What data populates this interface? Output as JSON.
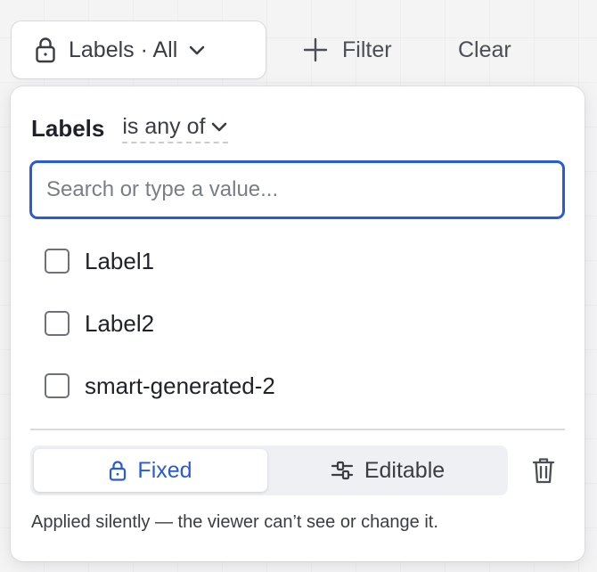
{
  "toolbar": {
    "labels_pill": {
      "label": "Labels · All",
      "lock_icon": "lock-icon",
      "chevron_icon": "chevron-down-icon"
    },
    "filter_button": {
      "label": "Filter",
      "icon": "plus-icon"
    },
    "clear_button": {
      "label": "Clear"
    }
  },
  "popover": {
    "title": "Labels",
    "operator": "is any of",
    "search": {
      "placeholder": "Search or type a value...",
      "value": ""
    },
    "options": [
      {
        "label": "Label1",
        "checked": false
      },
      {
        "label": "Label2",
        "checked": false
      },
      {
        "label": "smart-generated-2",
        "checked": false
      }
    ],
    "mode": {
      "selected": "Fixed",
      "fixed_label": "Fixed",
      "editable_label": "Editable"
    },
    "hint": "Applied silently — the viewer can’t see or change it."
  },
  "colors": {
    "accent": "#2a5bd7",
    "text": "#1f2328",
    "muted": "#3a3d42",
    "border": "#d9d9de"
  }
}
